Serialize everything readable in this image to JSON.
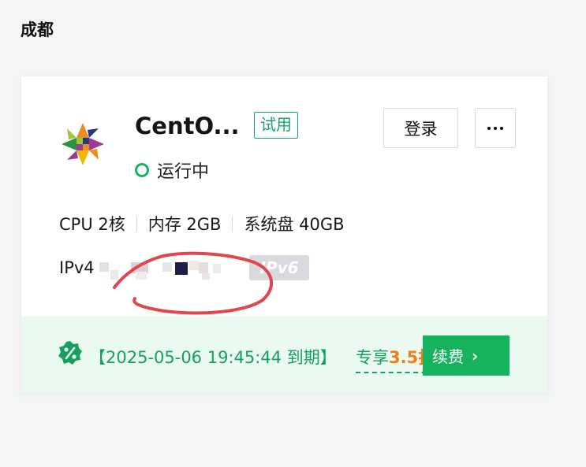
{
  "region": {
    "title": "成都"
  },
  "instance": {
    "name": "CentO...",
    "badge": "试用",
    "status": "运行中",
    "os_icon": "centos-logo-icon"
  },
  "actions": {
    "login_label": "登录",
    "more_icon": "more-horizontal-icon"
  },
  "specs": {
    "cpu": "CPU 2核",
    "memory": "内存 2GB",
    "disk": "系统盘 40GB"
  },
  "network": {
    "ipv4_label": "IPv4",
    "ipv6_badge": "IPv6"
  },
  "footer": {
    "expiry_text": "【2025-05-06 19:45:44 到期】",
    "promo_prefix": "专享",
    "promo_number": "3.5",
    "promo_suffix": "折",
    "renew_label": "续费",
    "discount_icon": "discount-badge-icon"
  },
  "colors": {
    "accent_green": "#16b35f",
    "promo_orange": "#f07d16",
    "annotation_red": "#e0464e"
  }
}
